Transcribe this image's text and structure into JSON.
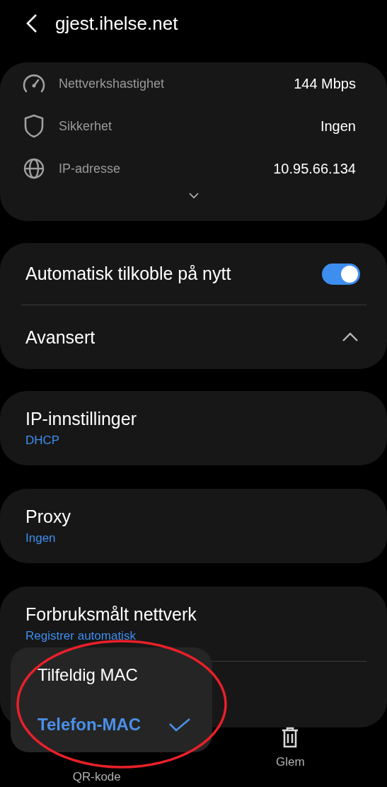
{
  "header": {
    "title": "gjest.ihelse.net"
  },
  "info": [
    {
      "kind": "speed",
      "label": "Nettverkshastighet",
      "value": "144 Mbps"
    },
    {
      "kind": "security",
      "label": "Sikkerhet",
      "value": "Ingen"
    },
    {
      "kind": "ip",
      "label": "IP-adresse",
      "value": "10.95.66.134"
    }
  ],
  "auto_reconnect": {
    "label": "Automatisk tilkoble på nytt",
    "on": true
  },
  "advanced": {
    "label": "Avansert",
    "expanded": true
  },
  "settings": [
    {
      "title": "IP-innstillinger",
      "subtitle": "DHCP"
    },
    {
      "title": "Proxy",
      "subtitle": "Ingen"
    },
    {
      "title": "Forbruksmålt nettverk",
      "subtitle": "Registrer automatisk"
    }
  ],
  "mac_menu": [
    {
      "label": "Tilfeldig MAC",
      "selected": false
    },
    {
      "label": "Telefon-MAC",
      "selected": true
    }
  ],
  "bottom_bar": [
    {
      "kind": "qr",
      "label": "QR-kode"
    },
    {
      "kind": "delete",
      "label": "Glem"
    }
  ]
}
